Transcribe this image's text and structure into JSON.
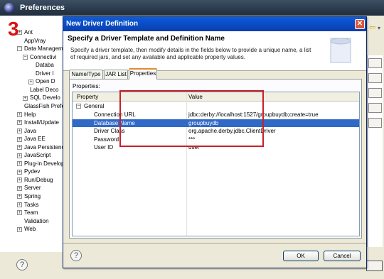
{
  "prefs": {
    "title": "Preferences",
    "annotation_number": "3",
    "tree": [
      {
        "label": "Ant",
        "expander": "+"
      },
      {
        "label": "AppVray",
        "expander": ""
      },
      {
        "label": "Data Managem",
        "expander": "−"
      },
      {
        "label": "Connectivi",
        "expander": "−"
      },
      {
        "label": "Databa",
        "expander": ""
      },
      {
        "label": "Driver I",
        "expander": ""
      },
      {
        "label": "Open D",
        "expander": "+"
      },
      {
        "label": "Label Deco",
        "expander": ""
      },
      {
        "label": "SQL Develo",
        "expander": "+"
      },
      {
        "label": "GlassFish Prefe",
        "expander": ""
      },
      {
        "label": "Help",
        "expander": "+"
      },
      {
        "label": "Install/Update",
        "expander": "+"
      },
      {
        "label": "Java",
        "expander": "+"
      },
      {
        "label": "Java EE",
        "expander": "+"
      },
      {
        "label": "Java Persistenc",
        "expander": "+"
      },
      {
        "label": "JavaScript",
        "expander": "+"
      },
      {
        "label": "Plug-in Develop",
        "expander": "+"
      },
      {
        "label": "Pydev",
        "expander": "+"
      },
      {
        "label": "Run/Debug",
        "expander": "+"
      },
      {
        "label": "Server",
        "expander": "+"
      },
      {
        "label": "Spring",
        "expander": "+"
      },
      {
        "label": "Tasks",
        "expander": "+"
      },
      {
        "label": "Team",
        "expander": "+"
      },
      {
        "label": "Validation",
        "expander": ""
      },
      {
        "label": "Web",
        "expander": "+"
      }
    ],
    "help_icon": "?",
    "back_icon": "⇦",
    "more_icon": "▾"
  },
  "dialog": {
    "title": "New Driver Definition",
    "close_icon": "✕",
    "heading": "Specify a Driver Template and Definition Name",
    "description": "Specify a driver template, then modify details in the fields below to provide a unique name, a list of required jars, and set any available and applicable property values.",
    "tabs": [
      "Name/Type",
      "JAR List",
      "Properties"
    ],
    "active_tab": "Properties",
    "properties_label": "Properties:",
    "columns": [
      "Property",
      "Value"
    ],
    "group": {
      "label": "General",
      "expander": "−"
    },
    "properties": [
      {
        "name": "Connection URL",
        "value": "jdbc:derby://localhost:1527/groupbuydb;create=true",
        "selected": false
      },
      {
        "name": "Database Name",
        "value": "groupbuydb",
        "selected": true
      },
      {
        "name": "Driver Class",
        "value": "org.apache.derby.jdbc.ClientDriver",
        "selected": false
      },
      {
        "name": "Password",
        "value": "***",
        "selected": false
      },
      {
        "name": "User ID",
        "value": "user",
        "selected": false
      }
    ],
    "help_icon": "?",
    "ok_label": "OK",
    "cancel_label": "Cancel",
    "colors": {
      "highlight_box": "#c8202a",
      "selection": "#3169c6",
      "titlebar": "#0a4fc8"
    }
  }
}
